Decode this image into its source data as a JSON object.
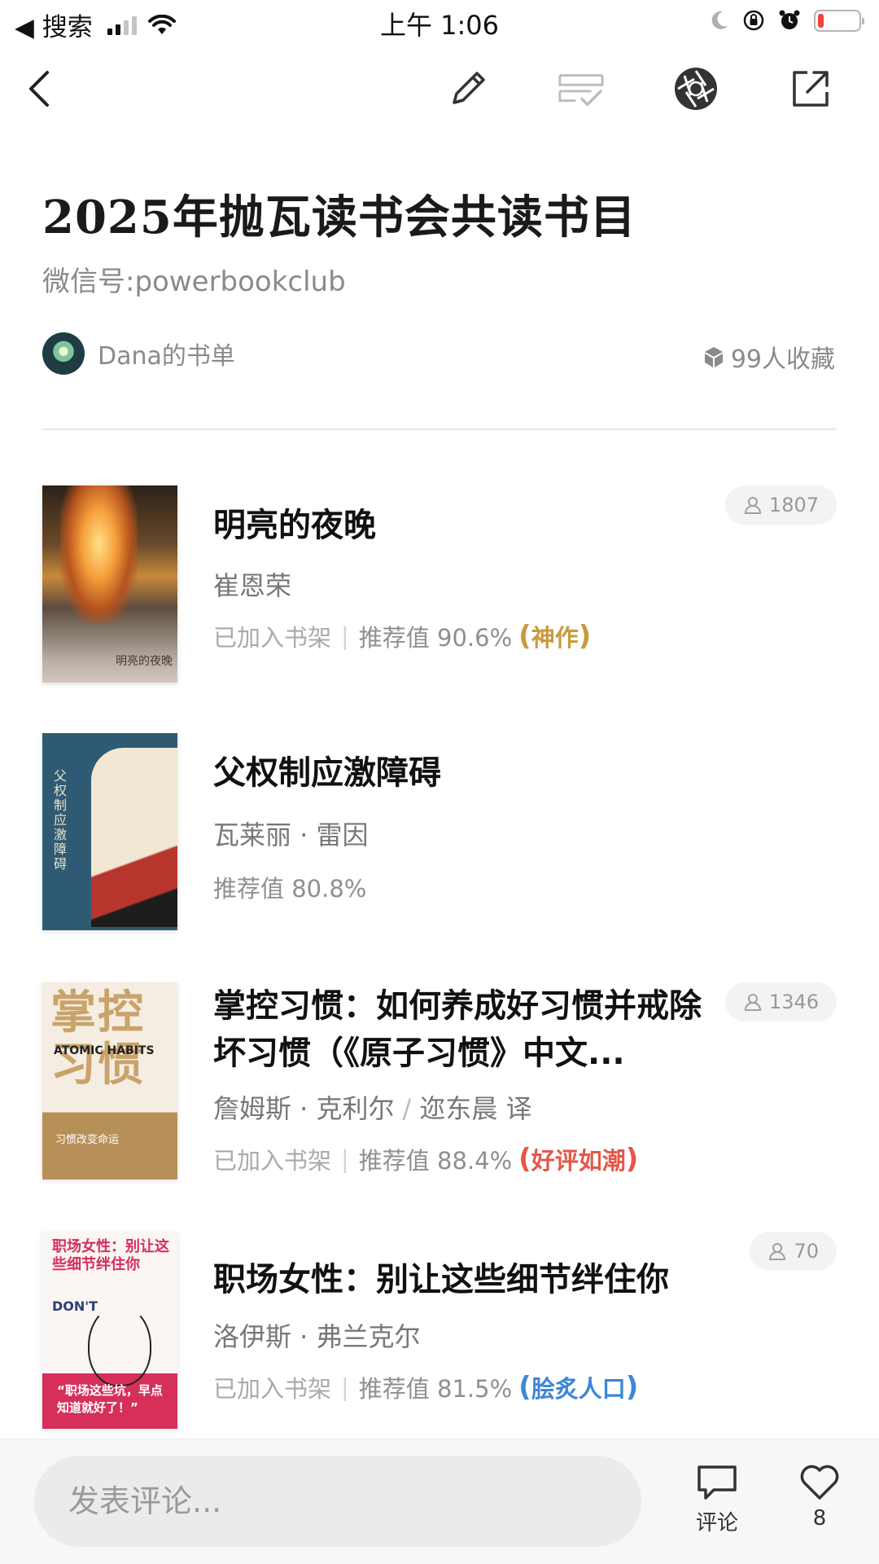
{
  "status_bar": {
    "back_label": "◀ 搜索",
    "time": "上午 1:06",
    "battery_level": 0.15
  },
  "nav": {
    "icons": [
      "back-icon",
      "edit-icon",
      "manage-icon",
      "share-moments-icon",
      "share-external-icon"
    ]
  },
  "header": {
    "title": "2025年抛瓦读书会共读书目",
    "subtitle": "微信号:powerbookclub",
    "author": "Dana的书单",
    "collect_count": "99人收藏"
  },
  "books": [
    {
      "title": "明亮的夜晚",
      "author": "崔恩荣",
      "translator": "",
      "on_shelf": "已加入书架",
      "recommend": "推荐值 90.6%",
      "badge": "神作",
      "readers": "1807",
      "cover_text": "明亮的夜晚"
    },
    {
      "title": "父权制应激障碍",
      "author": "瓦莱丽 · 雷因",
      "translator": "",
      "on_shelf": "",
      "recommend": "推荐值 80.8%",
      "badge": "",
      "readers": "",
      "cover_text": "父权制应激障碍"
    },
    {
      "title": "掌控习惯：如何养成好习惯并戒除坏习惯（《原子习惯》中文...",
      "author": "詹姆斯 · 克利尔",
      "translator": "迩东晨 译",
      "on_shelf": "已加入书架",
      "recommend": "推荐值 88.4%",
      "badge": "好评如潮",
      "readers": "1346",
      "cover_text": "掌控习惯",
      "cover_en": "ATOMIC HABITS",
      "cover_low": "习惯改变命运"
    },
    {
      "title": "职场女性：别让这些细节绊住你",
      "author": "洛伊斯 · 弗兰克尔",
      "translator": "",
      "on_shelf": "已加入书架",
      "recommend": "推荐值 81.5%",
      "badge": "脍炙人口",
      "readers": "70",
      "cover_text": "职场女性：别让这些细节绊住你",
      "cover_en": "DON'T",
      "cover_low": "“职场这些坑，早点知道就好了！”"
    }
  ],
  "colors": {
    "badge_godlike": "#c99a3c",
    "badge_acclaimed": "#e4574a",
    "badge_popular": "#3e86d9"
  },
  "bottom": {
    "comment_placeholder": "发表评论...",
    "comment_label": "评论",
    "like_count": "8"
  }
}
